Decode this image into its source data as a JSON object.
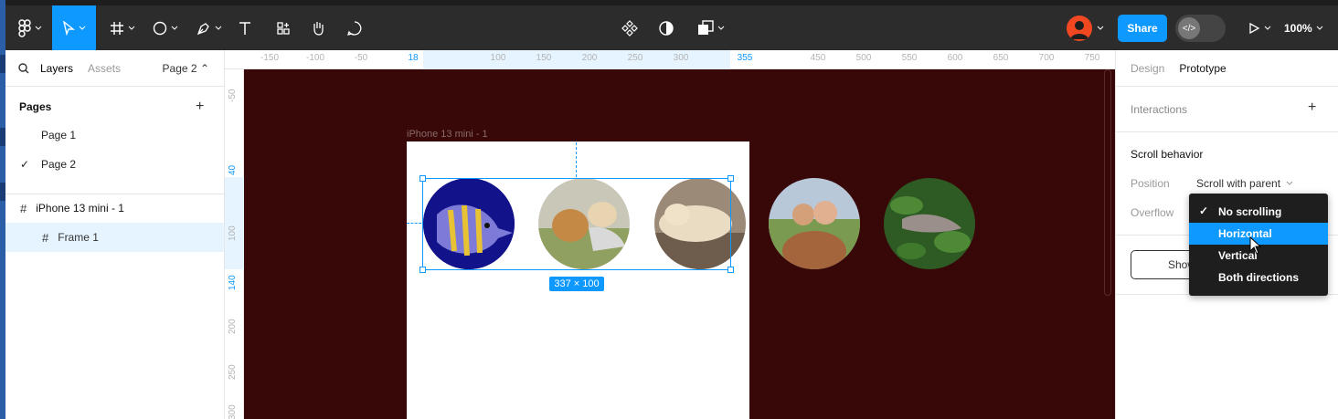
{
  "toolbar": {
    "share_label": "Share",
    "zoom_label": "100%",
    "dev_mode_label": "</>"
  },
  "left_panel": {
    "tabs": [
      "Layers",
      "Assets"
    ],
    "page_selector": "Page 2",
    "pages_title": "Pages",
    "pages": [
      {
        "label": "Page 1",
        "checked": false
      },
      {
        "label": "Page 2",
        "checked": true
      }
    ],
    "layers": [
      {
        "label": "iPhone 13 mini - 1",
        "selected": false
      },
      {
        "label": "Frame 1",
        "selected": true
      }
    ]
  },
  "rulers": {
    "top": [
      "-150",
      "-100",
      "-50",
      "18",
      "100",
      "150",
      "200",
      "250",
      "300",
      "355",
      "450",
      "500",
      "550",
      "600",
      "650",
      "700",
      "750"
    ],
    "left": [
      "-50",
      "40",
      "100",
      "140",
      "200",
      "250",
      "300"
    ]
  },
  "canvas": {
    "frame_label": "iPhone 13 mini - 1",
    "selection_size": "337 × 100",
    "background": "#380808"
  },
  "right_panel": {
    "tabs": [
      "Design",
      "Prototype"
    ],
    "interactions_label": "Interactions",
    "scroll_behavior_label": "Scroll behavior",
    "position_label": "Position",
    "position_value": "Scroll with parent",
    "overflow_label": "Overflow",
    "show_button_label": "Show"
  },
  "overflow_dropdown": {
    "options": [
      "No scrolling",
      "Horizontal",
      "Vertical",
      "Both directions"
    ],
    "checked": "No scrolling",
    "hovered": "Horizontal"
  },
  "colors": {
    "accent": "#0d99ff",
    "toolbar": "#2c2c2c"
  }
}
